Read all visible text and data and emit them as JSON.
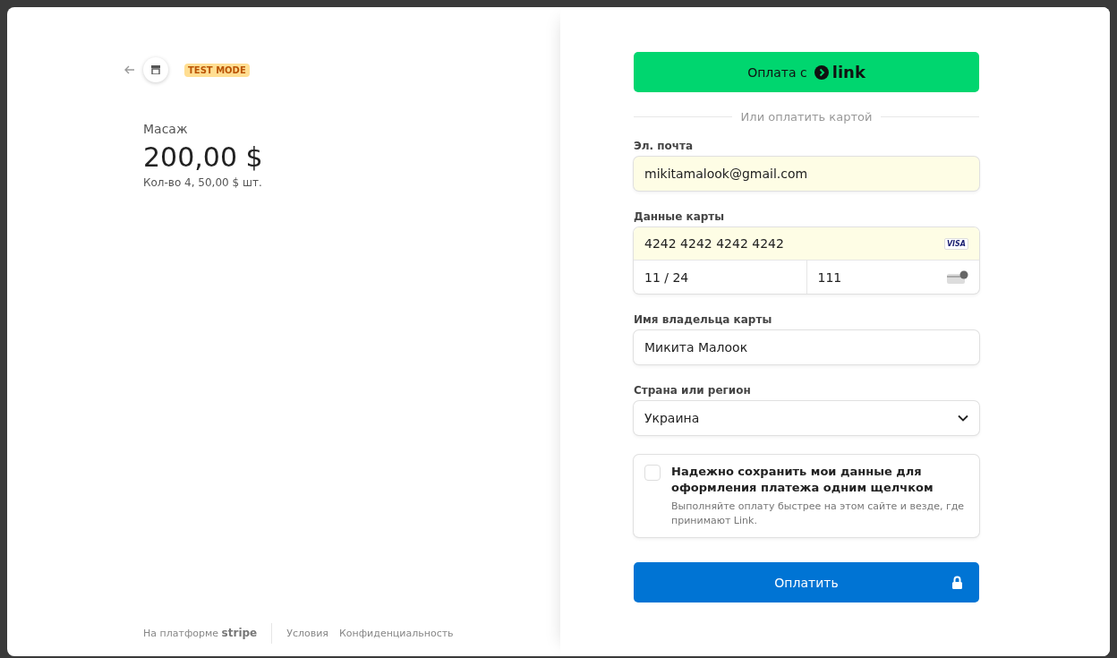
{
  "header": {
    "badge": "TEST MODE"
  },
  "product": {
    "name": "Масаж",
    "price": "200,00 $",
    "quantity": "Кол-во 4, 50,00 $ шт."
  },
  "footer": {
    "powered_by": "На платформе",
    "brand": "stripe",
    "links": [
      "Условия",
      "Конфиденциальность"
    ]
  },
  "link_button": {
    "label": "Оплата с",
    "brand": "link"
  },
  "divider": "Или оплатить картой",
  "email": {
    "label": "Эл. почта",
    "value": "mikitamalook@gmail.com"
  },
  "card": {
    "label": "Данные карты",
    "number": "4242 4242 4242 4242",
    "brand": "VISA",
    "expiry": "11 / 24",
    "cvc": "111"
  },
  "cardholder": {
    "label": "Имя владельца карты",
    "value": "Микита Малоок"
  },
  "country": {
    "label": "Страна или регион",
    "value": "Украина"
  },
  "save_info": {
    "checked": false,
    "title": "Надежно сохранить мои данные для оформления платежа одним щелчком",
    "description": "Выполняйте оплату быстрее на этом сайте и везде, где принимают Link."
  },
  "pay_button": {
    "label": "Оплатить"
  }
}
